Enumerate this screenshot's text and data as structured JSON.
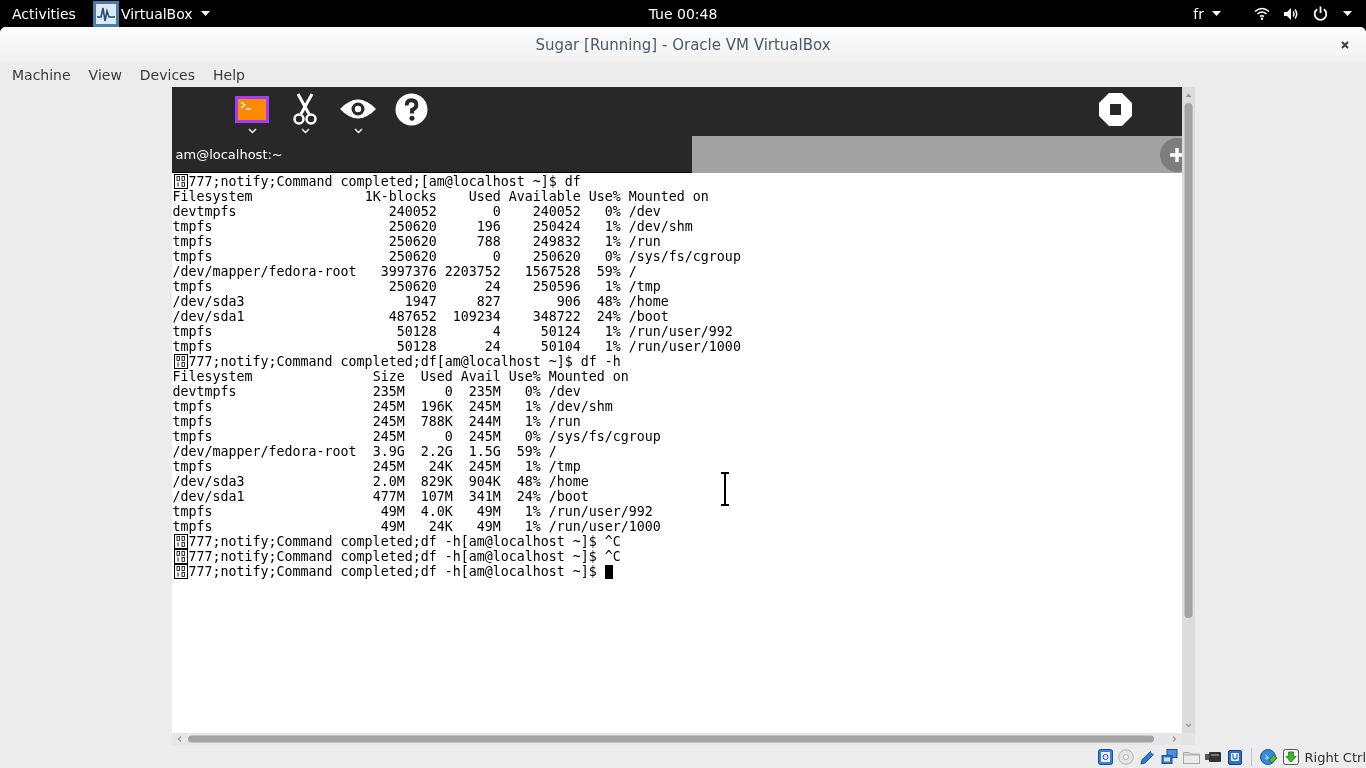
{
  "top_bar": {
    "activities": "Activities",
    "app_menu": "VirtualBox",
    "clock": "Tue 00:48",
    "keyboard_layout": "fr"
  },
  "window": {
    "title": "Sugar [Running] - Oracle VM VirtualBox"
  },
  "menu_bar": [
    "Machine",
    "View",
    "Devices",
    "Help"
  ],
  "vm_screen": {
    "tab_title": "am@localhost:~",
    "terminal": {
      "cursor": true,
      "lines": [
        {
          "kind": "prompt",
          "text": "777;notify;Command completed;[am@localhost ~]$ df"
        },
        {
          "kind": "output",
          "text": "Filesystem              1K-blocks    Used Available Use% Mounted on"
        },
        {
          "kind": "output",
          "text": "devtmpfs                   240052       0    240052   0% /dev"
        },
        {
          "kind": "output",
          "text": "tmpfs                      250620     196    250424   1% /dev/shm"
        },
        {
          "kind": "output",
          "text": "tmpfs                      250620     788    249832   1% /run"
        },
        {
          "kind": "output",
          "text": "tmpfs                      250620       0    250620   0% /sys/fs/cgroup"
        },
        {
          "kind": "output",
          "text": "/dev/mapper/fedora-root   3997376 2203752   1567528  59% /"
        },
        {
          "kind": "output",
          "text": "tmpfs                      250620      24    250596   1% /tmp"
        },
        {
          "kind": "output",
          "text": "/dev/sda3                    1947     827       906  48% /home"
        },
        {
          "kind": "output",
          "text": "/dev/sda1                  487652  109234    348722  24% /boot"
        },
        {
          "kind": "output",
          "text": "tmpfs                       50128       4     50124   1% /run/user/992"
        },
        {
          "kind": "output",
          "text": "tmpfs                       50128      24     50104   1% /run/user/1000"
        },
        {
          "kind": "prompt",
          "text": "777;notify;Command completed;df[am@localhost ~]$ df -h"
        },
        {
          "kind": "output",
          "text": "Filesystem               Size  Used Avail Use% Mounted on"
        },
        {
          "kind": "output",
          "text": "devtmpfs                 235M     0  235M   0% /dev"
        },
        {
          "kind": "output",
          "text": "tmpfs                    245M  196K  245M   1% /dev/shm"
        },
        {
          "kind": "output",
          "text": "tmpfs                    245M  788K  244M   1% /run"
        },
        {
          "kind": "output",
          "text": "tmpfs                    245M     0  245M   0% /sys/fs/cgroup"
        },
        {
          "kind": "output",
          "text": "/dev/mapper/fedora-root  3.9G  2.2G  1.5G  59% /"
        },
        {
          "kind": "output",
          "text": "tmpfs                    245M   24K  245M   1% /tmp"
        },
        {
          "kind": "output",
          "text": "/dev/sda3                2.0M  829K  904K  48% /home"
        },
        {
          "kind": "output",
          "text": "/dev/sda1                477M  107M  341M  24% /boot"
        },
        {
          "kind": "output",
          "text": "tmpfs                     49M  4.0K   49M   1% /run/user/992"
        },
        {
          "kind": "output",
          "text": "tmpfs                     49M   24K   49M   1% /run/user/1000"
        },
        {
          "kind": "prompt",
          "text": "777;notify;Command completed;df -h[am@localhost ~]$ ^C"
        },
        {
          "kind": "prompt",
          "text": "777;notify;Command completed;df -h[am@localhost ~]$ ^C"
        },
        {
          "kind": "prompt",
          "text": "777;notify;Command completed;df -h[am@localhost ~]$"
        }
      ]
    }
  },
  "status_bar": {
    "host_key": "Right Ctrl"
  }
}
